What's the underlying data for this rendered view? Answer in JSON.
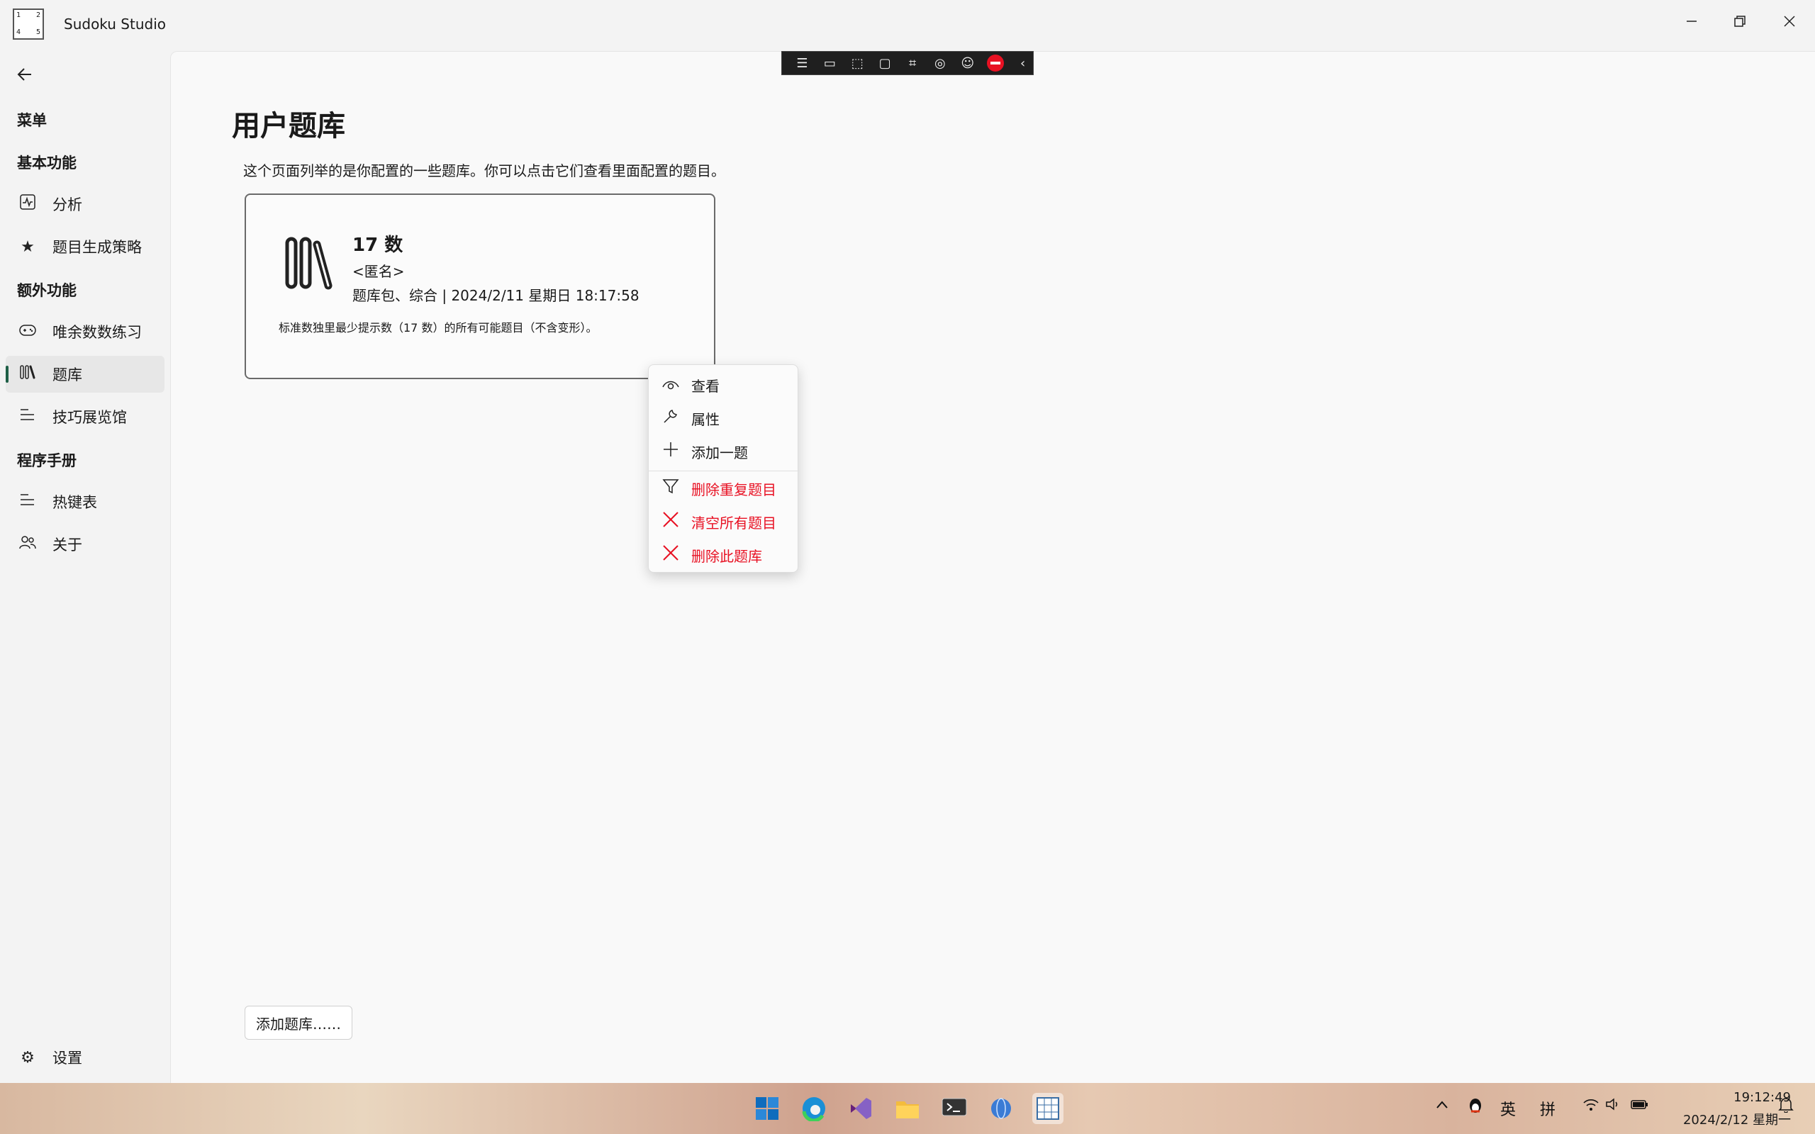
{
  "app": {
    "title": "Sudoku Studio",
    "logo_digits": [
      "1",
      "2",
      "4",
      "5"
    ]
  },
  "window_controls": {
    "minimize_icon": "minimize-icon",
    "restore_icon": "restore-icon",
    "close_icon": "close-icon"
  },
  "sidebar": {
    "menu_header": "菜单",
    "section_basic": "基本功能",
    "analysis": "分析",
    "strategy": "题目生成策略",
    "section_extra": "额外功能",
    "practice": "唯余数数练习",
    "library": "题库",
    "gallery": "技巧展览馆",
    "section_manual": "程序手册",
    "hotkeys": "热键表",
    "about": "关于",
    "settings": "设置"
  },
  "page": {
    "title": "用户题库",
    "description": "这个页面列举的是你配置的一些题库。你可以点击它们查看里面配置的题目。",
    "add_button": "添加题库……"
  },
  "library_card": {
    "name": "17 数",
    "author": "<匿名>",
    "meta": "题库包、综合 | 2024/2/11 星期日 18:17:58",
    "description": "标准数独里最少提示数（17 数）的所有可能题目（不含变形）。"
  },
  "context_menu": {
    "view": "查看",
    "properties": "属性",
    "add_one": "添加一题",
    "remove_duplicates": "删除重复题目",
    "clear_all": "清空所有题目",
    "delete_library": "删除此题库",
    "danger_color": "#e81123"
  },
  "taskbar": {
    "tray_lang": "英",
    "tray_ime": "拼",
    "time": "19:12:49",
    "date": "2024/2/12 星期一"
  },
  "colors": {
    "accent": "#1e5f46",
    "danger": "#e81123",
    "content_bg": "#f9f9f9",
    "sidebar_bg": "#f3f3f3"
  }
}
